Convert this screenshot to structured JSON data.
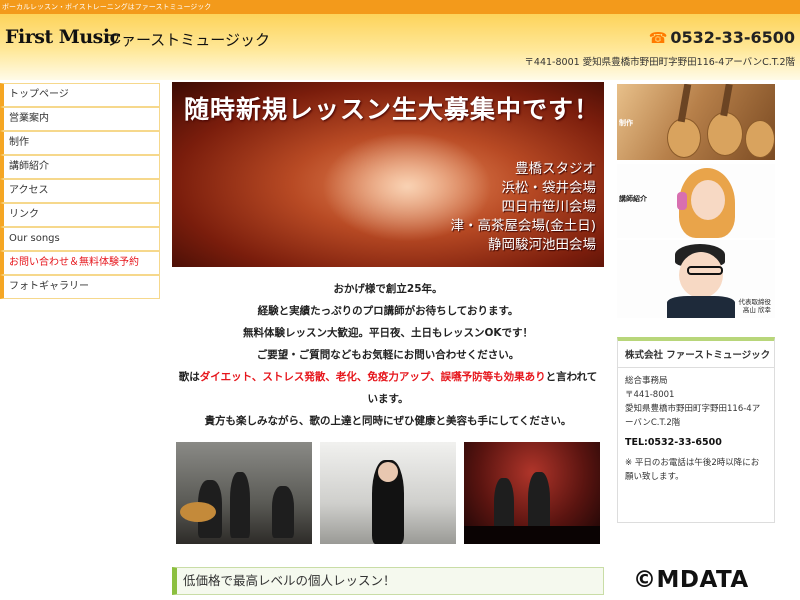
{
  "topbar": {
    "tagline": "ボーカルレッスン・ボイストレーニングはファーストミュージック"
  },
  "header": {
    "logo_en": "First Music",
    "logo_ja": "ファーストミュージック",
    "phone": "0532-33-6500",
    "phone_icon": "phone-icon",
    "address": "〒441-8001 愛知県豊橋市野田町字野田116-4アーバンC.T.2階"
  },
  "nav": {
    "items": [
      {
        "label": "トップページ"
      },
      {
        "label": "営業案内"
      },
      {
        "label": "制作"
      },
      {
        "label": "講師紹介"
      },
      {
        "label": "アクセス"
      },
      {
        "label": "リンク"
      },
      {
        "label": "Our songs"
      },
      {
        "label": "お問い合わせ＆無料体験予約"
      },
      {
        "label": "フォトギャラリー"
      }
    ]
  },
  "hero": {
    "title": "随時新規レッスン生大募集中です！",
    "locations": [
      "豊橋スタジオ",
      "浜松・袋井会場",
      "四日市笹川会場",
      "津・高茶屋会場(金土日)",
      "静岡駿河池田会場"
    ]
  },
  "intro": {
    "line1": "おかげ様で創立25年。",
    "line2": "経験と実績たっぷりのプロ講師がお待ちしております。",
    "line3": "無料体験レッスン大歓迎。平日夜、土日もレッスンOKです！",
    "line4": "ご要望・ご質問などもお気軽にお問い合わせください。",
    "line5_pre": "歌は",
    "line5_highlight": "ダイエット、ストレス発散、老化、免疫力アップ、誤嚥予防等も効果あり",
    "line5_post": "と言われて",
    "line6": "います。",
    "line7": "貴方も楽しみながら、歌の上達と同時にぜひ健康と美容も手にしてください。"
  },
  "bottom_box": {
    "title": "低価格で最高レベルの個人レッスン！"
  },
  "sidebar": {
    "img1_label": "制作",
    "img2_label": "講師紹介",
    "img3_caption_1": "代表取締役",
    "img3_caption_2": "高山 欣幸"
  },
  "company": {
    "name": "株式会社 ファーストミュージック",
    "office": "総合事務局",
    "postal": "〒441-8001",
    "address": "愛知県豊橋市野田町字野田116-4アーバンC.T.2階",
    "tel": "TEL:0532-33-6500",
    "note": "※ 平日のお電話は午後2時以降にお願い致します。"
  },
  "watermark": "©MDATA",
  "colors": {
    "accent": "#f39a1b",
    "highlight": "#e6161c",
    "green": "#8cbf3f"
  }
}
